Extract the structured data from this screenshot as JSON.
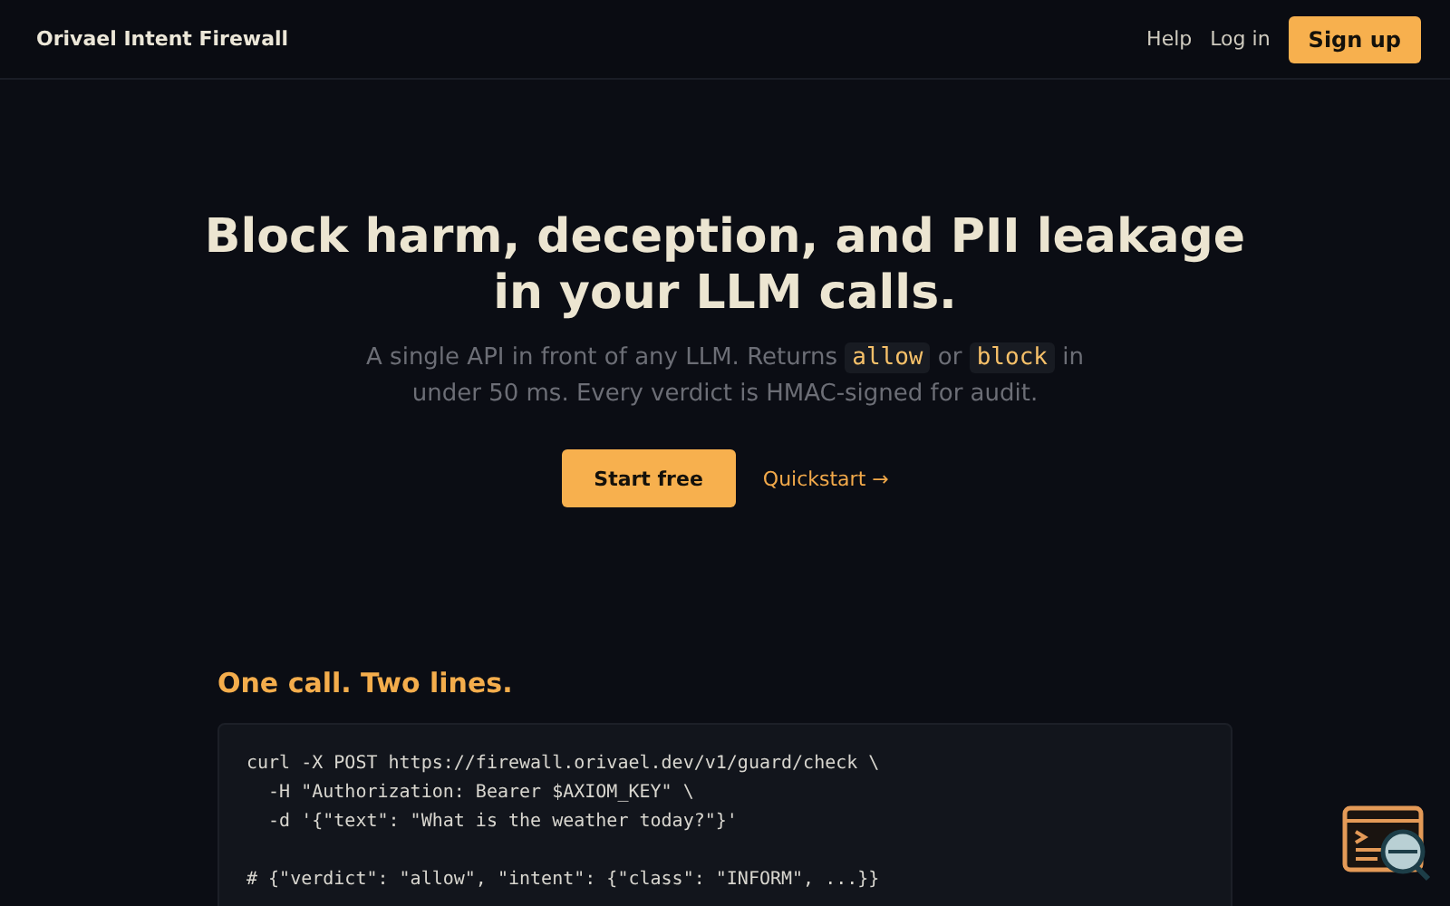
{
  "header": {
    "brand": "Orivael Intent Firewall",
    "links": [
      "Help",
      "Log in"
    ],
    "cta": "Sign up"
  },
  "hero": {
    "title": "Block harm, deception, and PII leakage in your LLM calls.",
    "subtitle": [
      {
        "kind": "text",
        "text": "A single API in front of any LLM. Returns "
      },
      {
        "kind": "code",
        "text": "allow"
      },
      {
        "kind": "text",
        "text": " or "
      },
      {
        "kind": "code",
        "text": "block"
      },
      {
        "kind": "text",
        "text": " in under 50 ms. Every verdict is HMAC-signed for audit."
      }
    ],
    "primary_button": "Start free",
    "secondary_link": "Quickstart →"
  },
  "section": {
    "heading": "One call. Two lines.",
    "command": [
      "curl -X POST https://firewall.orivael.dev/v1/guard/check \\",
      "  -H \"Authorization: Bearer $AXIOM_KEY\" \\",
      "  -d '{\"text\": \"What is the weather today?\"}'"
    ],
    "comment": "# {\"verdict\": \"allow\", \"intent\": {\"class\": \"INFORM\", ...}}"
  }
}
